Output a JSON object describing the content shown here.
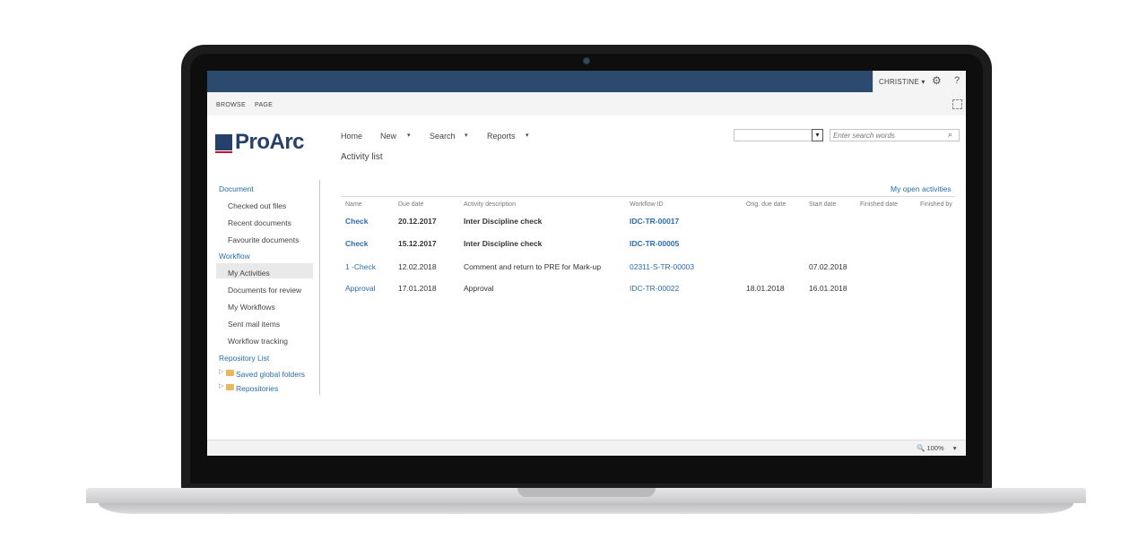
{
  "suitebar": {
    "user": "CHRISTINE",
    "user_caret": "▾",
    "gear_icon": "gear-icon",
    "help": "?"
  },
  "ribbon": {
    "tabs": [
      "BROWSE",
      "PAGE"
    ]
  },
  "logo": {
    "text": "ProArc"
  },
  "topnav": {
    "items": [
      "Home",
      "New",
      "Search",
      "Reports"
    ],
    "caret": "▾"
  },
  "page_title": "Activity list",
  "search": {
    "placeholder": "Enter search words",
    "dropdown_arrow": "▾",
    "icon": "⌕"
  },
  "leftnav": {
    "document_header": "Document",
    "document_items": [
      "Checked out files",
      "Recent documents",
      "Favourite documents"
    ],
    "workflow_header": "Workflow",
    "workflow_items": [
      "My Activities",
      "Documents for review",
      "My Workflows",
      "Sent mail items",
      "Workflow tracking"
    ],
    "selected": "My Activities",
    "repository_header": "Repository List",
    "tree": [
      "Saved global folders",
      "Repositories"
    ],
    "tree_caret": "▷"
  },
  "activity_view": "My open activities",
  "columns": [
    "Name",
    "Due date",
    "Activity description",
    "Workflow ID",
    "Orig. due date",
    "Start date",
    "Finished date",
    "Finished by"
  ],
  "rows": [
    {
      "name": "Check",
      "due": "20.12.2017",
      "desc": "Inter Discipline check",
      "wf": "IDC-TR-00017",
      "orig": "",
      "start": "",
      "bold": true
    },
    {
      "name": "Check",
      "due": "15.12.2017",
      "desc": "Inter Discipline check",
      "wf": "IDC-TR-00005",
      "orig": "",
      "start": "",
      "bold": true
    },
    {
      "name": "1 -Check",
      "due": "12.02.2018",
      "desc": "Comment and return to PRE for Mark-up",
      "wf": "02311-S-TR-00003",
      "orig": "",
      "start": "07.02.2018",
      "bold": false
    },
    {
      "name": "Approval",
      "due": "17.01.2018",
      "desc": "Approval",
      "wf": "IDC-TR-00022",
      "orig": "18.01.2018",
      "start": "16.01.2018",
      "bold": false
    }
  ],
  "status": {
    "zoom": "100%",
    "zoom_caret": "▾"
  }
}
